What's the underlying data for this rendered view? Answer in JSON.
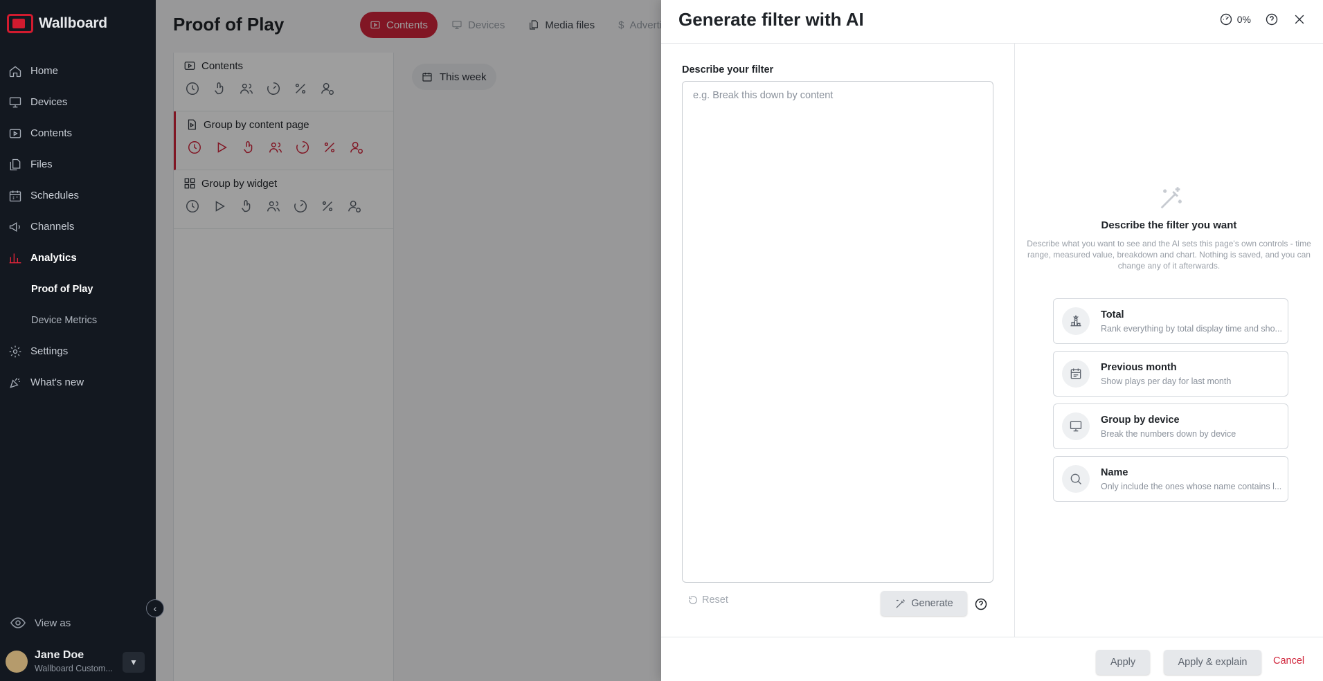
{
  "app": {
    "name": "Wallboard",
    "brand_color": "#d0243a"
  },
  "sidebar": {
    "items": [
      {
        "label": "Home",
        "icon": "home-icon"
      },
      {
        "label": "Devices",
        "icon": "monitor-icon"
      },
      {
        "label": "Contents",
        "icon": "play-icon"
      },
      {
        "label": "Files",
        "icon": "files-icon"
      },
      {
        "label": "Schedules",
        "icon": "calendar-icon"
      },
      {
        "label": "Channels",
        "icon": "megaphone-icon"
      },
      {
        "label": "Analytics",
        "icon": "chart-icon",
        "active": true
      },
      {
        "label": "Settings",
        "icon": "gear-icon"
      },
      {
        "label": "What's new",
        "icon": "confetti-icon"
      }
    ],
    "analytics_sub": [
      "Proof of Play",
      "Device Metrics"
    ],
    "view_as": "View as",
    "user": {
      "name": "Jane Doe",
      "org": "Wallboard Custom..."
    }
  },
  "main": {
    "title": "Proof of Play",
    "tabs": [
      {
        "label": "Contents",
        "active": true
      },
      {
        "label": "Devices"
      },
      {
        "label": "Media files"
      },
      {
        "label": "Advertis"
      }
    ],
    "groups": [
      {
        "label": "Contents"
      },
      {
        "label": "Group by content page",
        "selected": true
      },
      {
        "label": "Group by widget"
      }
    ],
    "date_range": "This week"
  },
  "drawer": {
    "title": "Generate filter with AI",
    "usage": "0%",
    "field_label": "Describe your filter",
    "placeholder": "e.g. Break this down by content",
    "reset_label": "Reset",
    "generate_label": "Generate",
    "empty_title": "Describe the filter you want",
    "empty_desc": "Describe what you want to see and the AI sets this page's own controls - time range, measured value, breakdown and chart. Nothing is saved, and you can change any of it afterwards.",
    "suggestions": [
      {
        "title": "Total",
        "desc": "Rank everything by total display time and sho...",
        "icon": "ranking-icon"
      },
      {
        "title": "Previous month",
        "desc": "Show plays per day for last month",
        "icon": "calendar-icon"
      },
      {
        "title": "Group by device",
        "desc": "Break the numbers down by device",
        "icon": "monitor-icon"
      },
      {
        "title": "Name",
        "desc": "Only include the ones whose name contains l...",
        "icon": "search-icon"
      }
    ],
    "apply_label": "Apply",
    "apply_explain_label": "Apply & explain",
    "cancel_label": "Cancel"
  }
}
